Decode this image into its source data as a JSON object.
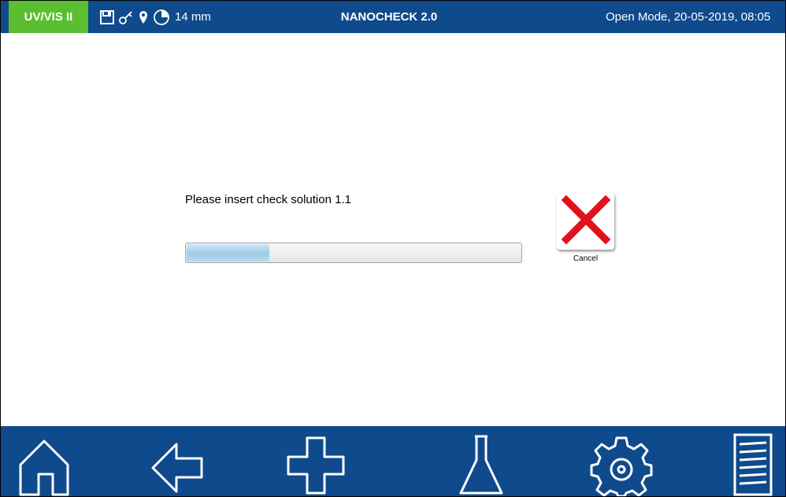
{
  "header": {
    "mode_tag": "UV/VIS II",
    "path_length": "14 mm",
    "app_title": "NANOCHECK 2.0",
    "status": "Open Mode, 20-05-2019, 08:05",
    "icons": [
      "save-icon",
      "key-icon",
      "location-pin-icon",
      "timer-icon"
    ]
  },
  "main": {
    "prompt": "Please insert check solution 1.1",
    "progress_fraction": 0.25,
    "cancel_label": "Cancel",
    "cancel_icon": "close-x-icon"
  },
  "nav": {
    "icons": [
      "home-icon",
      "back-arrow-icon",
      "add-plus-icon",
      "flask-icon",
      "settings-gear-icon",
      "menu-list-icon"
    ]
  },
  "colors": {
    "bar_blue": "#0f4a8c",
    "mode_green": "#5bbe31",
    "cancel_red": "#e2121b",
    "progress_fill": "#9fcbe6"
  }
}
